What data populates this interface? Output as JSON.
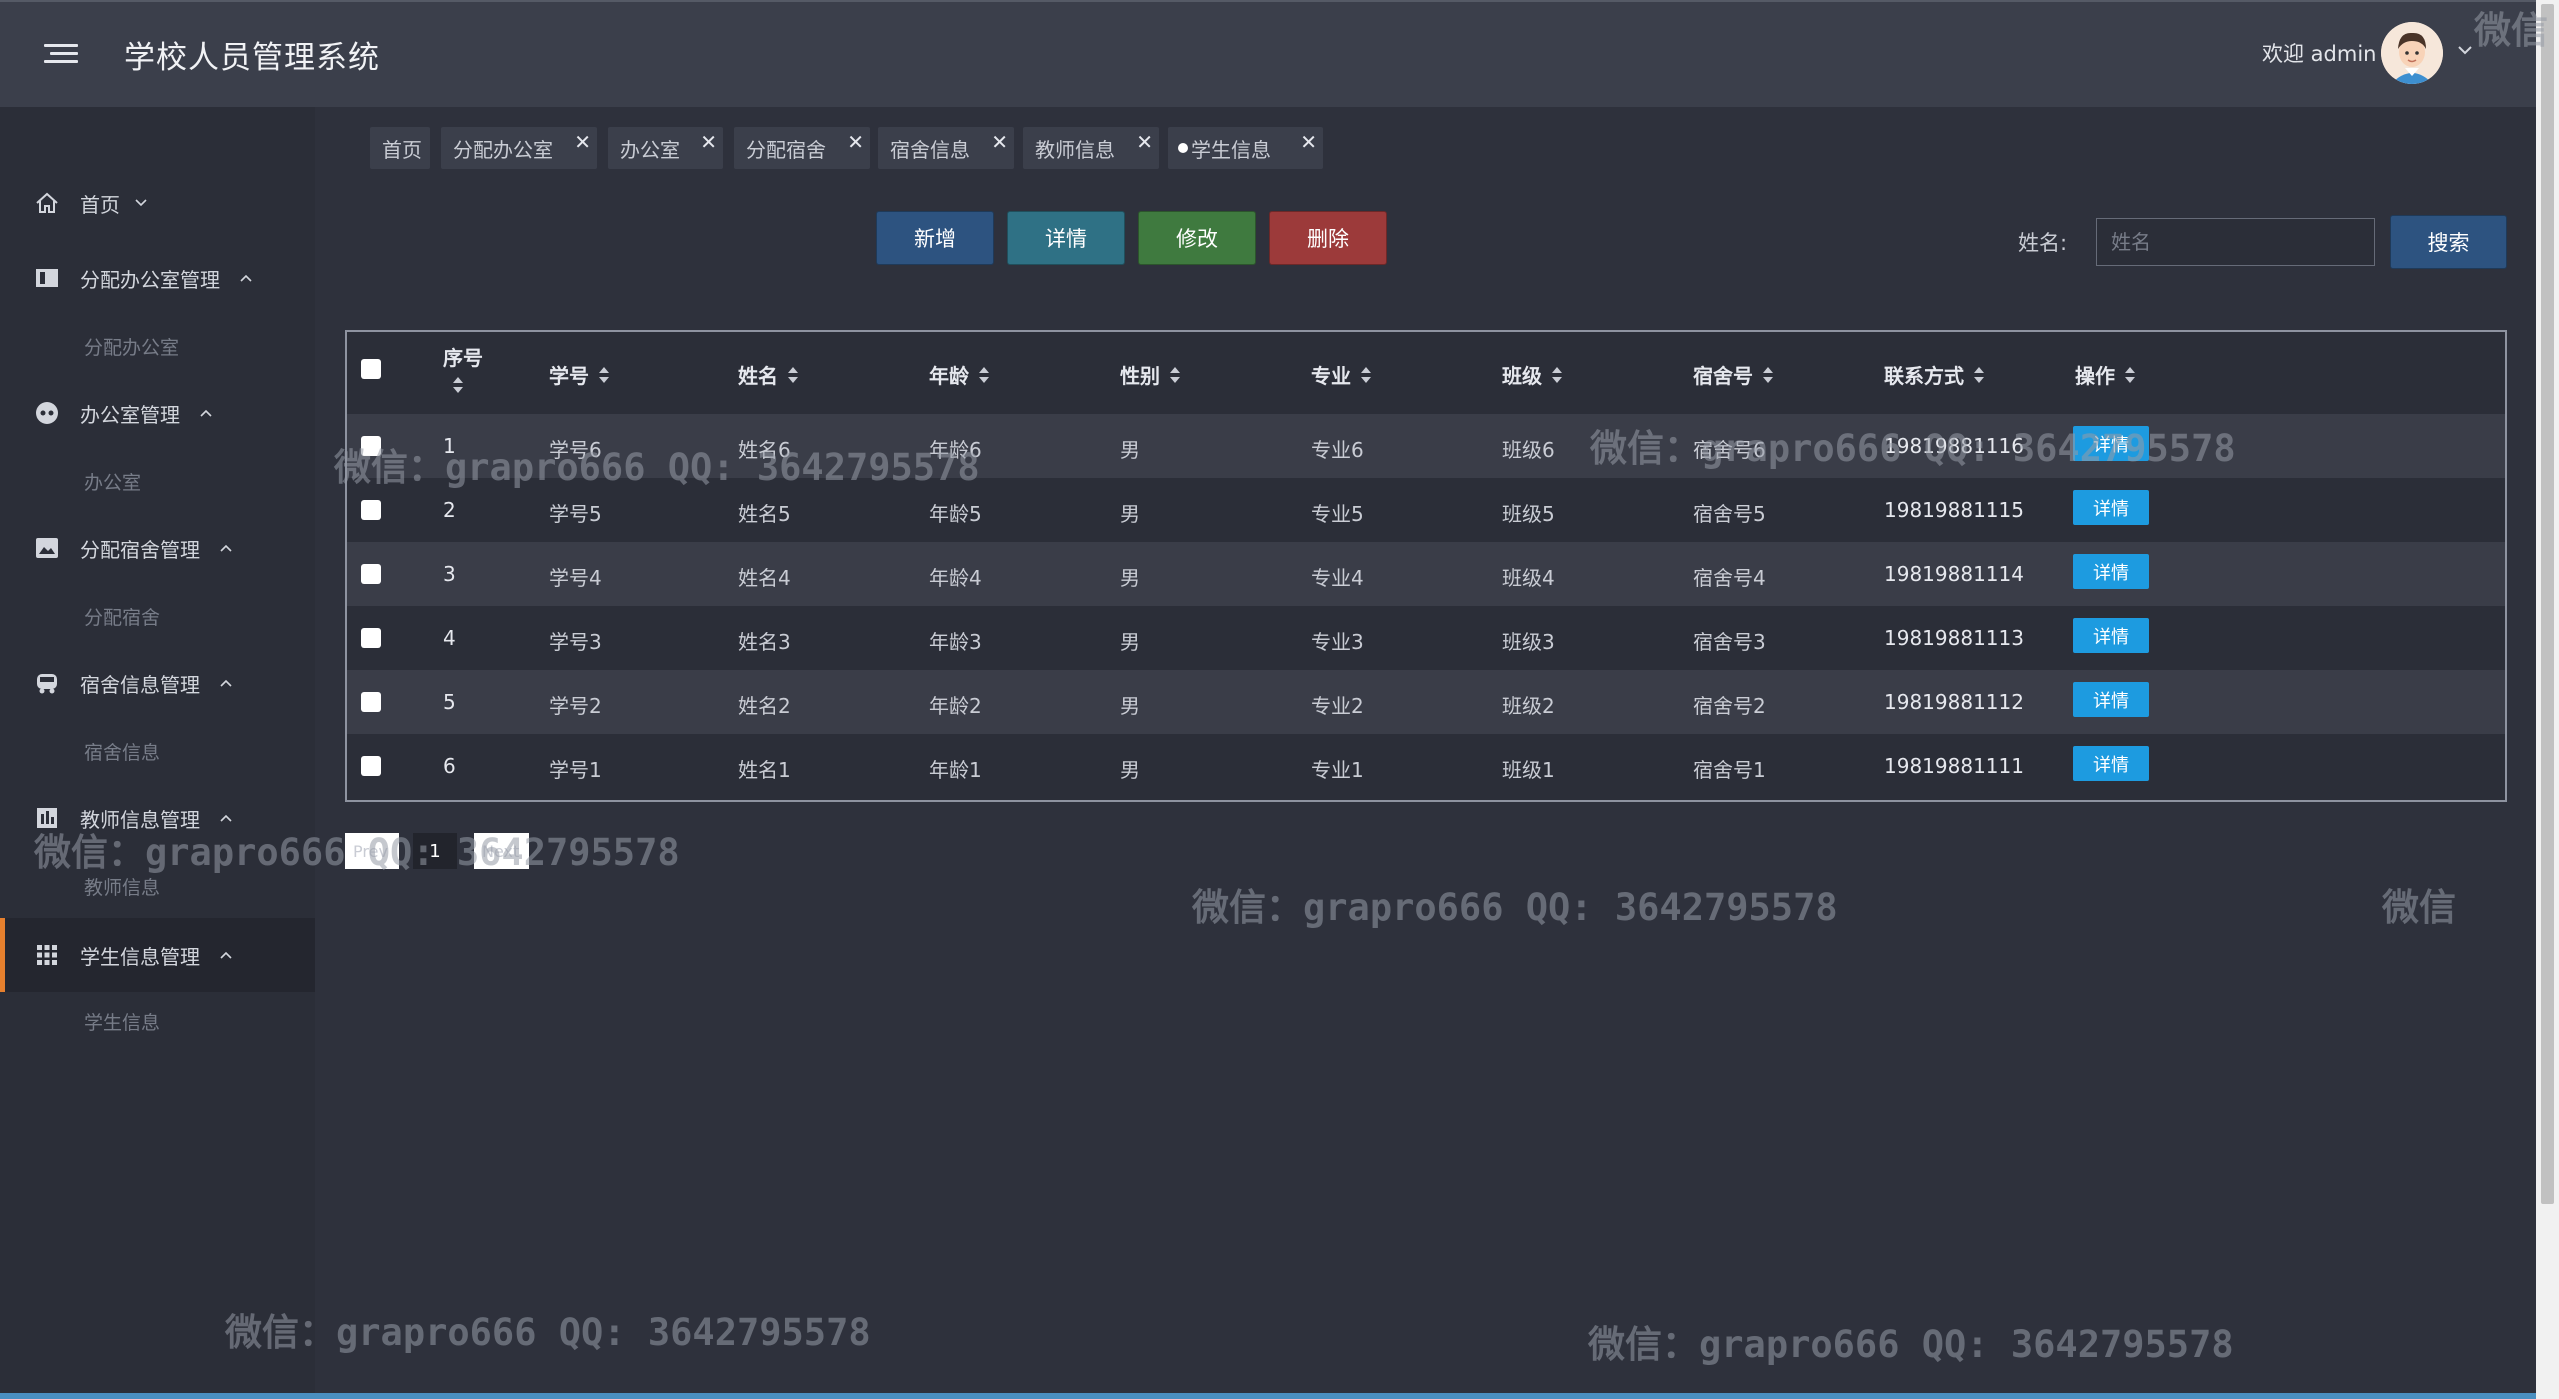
{
  "header": {
    "title": "学校人员管理系统",
    "welcome": "欢迎 admin",
    "menu_icon": "hamburger-icon",
    "avatar_icon": "user-avatar",
    "dropdown_icon": "chevron-down-icon"
  },
  "sidebar": {
    "items": [
      {
        "label": "首页",
        "icon": "home-icon",
        "chevron": "down",
        "sub": ""
      },
      {
        "label": "分配办公室管理",
        "icon": "panel-icon",
        "chevron": "up",
        "sub": "分配办公室"
      },
      {
        "label": "办公室管理",
        "icon": "dashboard-icon",
        "chevron": "up",
        "sub": "办公室"
      },
      {
        "label": "分配宿舍管理",
        "icon": "image-icon",
        "chevron": "up",
        "sub": "分配宿舍"
      },
      {
        "label": "宿舍信息管理",
        "icon": "bus-icon",
        "chevron": "up",
        "sub": "宿舍信息"
      },
      {
        "label": "教师信息管理",
        "icon": "chart-icon",
        "chevron": "up",
        "sub": "教师信息"
      },
      {
        "label": "学生信息管理",
        "icon": "grid-icon",
        "chevron": "up",
        "sub": "学生信息",
        "active": true
      }
    ]
  },
  "tags": [
    {
      "label": "首页",
      "closable": false
    },
    {
      "label": "分配办公室",
      "closable": true
    },
    {
      "label": "办公室",
      "closable": true
    },
    {
      "label": "分配宿舍",
      "closable": true
    },
    {
      "label": "宿舍信息",
      "closable": true
    },
    {
      "label": "教师信息",
      "closable": true
    },
    {
      "label": "学生信息",
      "closable": true,
      "active": true
    }
  ],
  "toolbar": {
    "add": "新增",
    "detail": "详情",
    "edit": "修改",
    "delete": "删除",
    "search_label": "姓名:",
    "search_placeholder": "姓名",
    "search_value": "",
    "search_button": "搜索"
  },
  "table": {
    "columns": [
      "序号",
      "学号",
      "姓名",
      "年龄",
      "性别",
      "专业",
      "班级",
      "宿舍号",
      "联系方式",
      "操作"
    ],
    "rows": [
      {
        "seq": "1",
        "sid": "学号6",
        "name": "姓名6",
        "age": "年龄6",
        "gender": "男",
        "major": "专业6",
        "cls": "班级6",
        "dorm": "宿舍号6",
        "phone": "19819881116",
        "action": "详情"
      },
      {
        "seq": "2",
        "sid": "学号5",
        "name": "姓名5",
        "age": "年龄5",
        "gender": "男",
        "major": "专业5",
        "cls": "班级5",
        "dorm": "宿舍号5",
        "phone": "19819881115",
        "action": "详情"
      },
      {
        "seq": "3",
        "sid": "学号4",
        "name": "姓名4",
        "age": "年龄4",
        "gender": "男",
        "major": "专业4",
        "cls": "班级4",
        "dorm": "宿舍号4",
        "phone": "19819881114",
        "action": "详情"
      },
      {
        "seq": "4",
        "sid": "学号3",
        "name": "姓名3",
        "age": "年龄3",
        "gender": "男",
        "major": "专业3",
        "cls": "班级3",
        "dorm": "宿舍号3",
        "phone": "19819881113",
        "action": "详情"
      },
      {
        "seq": "5",
        "sid": "学号2",
        "name": "姓名2",
        "age": "年龄2",
        "gender": "男",
        "major": "专业2",
        "cls": "班级2",
        "dorm": "宿舍号2",
        "phone": "19819881112",
        "action": "详情"
      },
      {
        "seq": "6",
        "sid": "学号1",
        "name": "姓名1",
        "age": "年龄1",
        "gender": "男",
        "major": "专业1",
        "cls": "班级1",
        "dorm": "宿舍号1",
        "phone": "19819881111",
        "action": "详情"
      }
    ]
  },
  "pagination": {
    "prev": "Prev",
    "current": "1",
    "next": "Next"
  },
  "watermark": {
    "text": "微信：grapro666 QQ: 3642795578",
    "corner": "微信"
  },
  "colors": {
    "accent": "#e6802e",
    "primary": "#2d5380",
    "detail": "#1d9be0"
  }
}
